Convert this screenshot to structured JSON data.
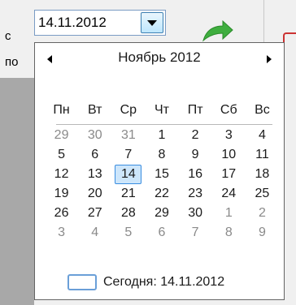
{
  "labels": {
    "from": "с",
    "to": "по"
  },
  "date_input": {
    "value": "14.11.2012"
  },
  "calendar": {
    "month_title": "Ноябрь 2012",
    "weekdays": [
      "Пн",
      "Вт",
      "Ср",
      "Чт",
      "Пт",
      "Сб",
      "Вс"
    ],
    "weeks": [
      [
        {
          "d": "29",
          "o": true
        },
        {
          "d": "30",
          "o": true
        },
        {
          "d": "31",
          "o": true
        },
        {
          "d": "1"
        },
        {
          "d": "2"
        },
        {
          "d": "3"
        },
        {
          "d": "4"
        }
      ],
      [
        {
          "d": "5"
        },
        {
          "d": "6"
        },
        {
          "d": "7"
        },
        {
          "d": "8"
        },
        {
          "d": "9"
        },
        {
          "d": "10"
        },
        {
          "d": "11"
        }
      ],
      [
        {
          "d": "12"
        },
        {
          "d": "13"
        },
        {
          "d": "14",
          "sel": true
        },
        {
          "d": "15"
        },
        {
          "d": "16"
        },
        {
          "d": "17"
        },
        {
          "d": "18"
        }
      ],
      [
        {
          "d": "19"
        },
        {
          "d": "20"
        },
        {
          "d": "21"
        },
        {
          "d": "22"
        },
        {
          "d": "23"
        },
        {
          "d": "24"
        },
        {
          "d": "25"
        }
      ],
      [
        {
          "d": "26"
        },
        {
          "d": "27"
        },
        {
          "d": "28"
        },
        {
          "d": "29"
        },
        {
          "d": "30"
        },
        {
          "d": "1",
          "o": true
        },
        {
          "d": "2",
          "o": true
        }
      ],
      [
        {
          "d": "3",
          "o": true
        },
        {
          "d": "4",
          "o": true
        },
        {
          "d": "5",
          "o": true
        },
        {
          "d": "6",
          "o": true
        },
        {
          "d": "7",
          "o": true
        },
        {
          "d": "8",
          "o": true
        },
        {
          "d": "9",
          "o": true
        }
      ]
    ],
    "today_label": "Сегодня: 14.11.2012"
  },
  "icons": {
    "dropdown": "chevron-down-icon",
    "prev": "chevron-left-icon",
    "next": "chevron-right-icon",
    "go": "green-arrow-icon"
  },
  "colors": {
    "accent": "#3a8de0",
    "selected_bg": "#cde6fb",
    "other_month": "#8a8a8a"
  }
}
